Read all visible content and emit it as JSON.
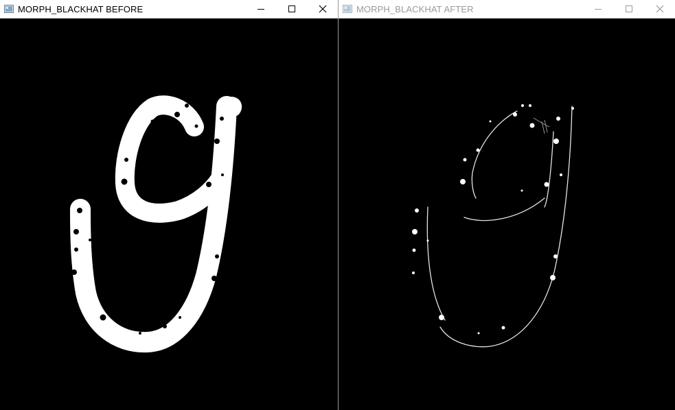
{
  "windows": [
    {
      "title": "MORPH_BLACKHAT BEFORE",
      "state": "active",
      "image": "binary white handwritten letter 'g' with black speckles on black background"
    },
    {
      "title": "MORPH_BLACKHAT AFTER",
      "state": "inactive",
      "image": "black-hat result: thin white outline edges and white dots on black background"
    }
  ],
  "icons": {
    "app": "opencv-window-icon",
    "minimize": "minimize-icon",
    "maximize": "maximize-icon",
    "close": "close-icon"
  },
  "colors": {
    "titlebar": "#ffffff",
    "canvas": "#000000",
    "active_title": "#000000",
    "inactive_title": "#9a9a9a"
  }
}
